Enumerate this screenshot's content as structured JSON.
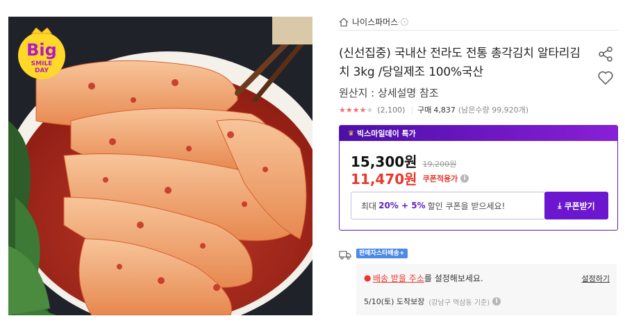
{
  "badge": {
    "line1": "Big",
    "line2": "SMILE",
    "line3": "DAY"
  },
  "seller": {
    "name": "나이스파머스"
  },
  "product": {
    "title": "(신선집중) 국내산 전라도 전통 총각김치 알타리김치 3kg /당일제조 100%국산",
    "origin": "원산지 : 상세설명 참조",
    "rating": 4.5,
    "review_count": "(2,100)",
    "purchase_label": "구매",
    "purchase_count": "4,837",
    "remaining": "(남은수량 99,920개)"
  },
  "deal": {
    "header": "빅스마일데이 특가",
    "price": "15,300원",
    "list_price": "19,200원",
    "coupon_price": "11,470원",
    "coupon_applied": "쿠폰적용가",
    "coupon_msg_prefix": "최대",
    "coupon_msg_highlight": "20% + 5%",
    "coupon_msg_suffix": "할인 쿠폰을 받으세요!",
    "coupon_button": "쿠폰받기"
  },
  "delivery": {
    "badge": "판매자스타배송+",
    "address_link": "배송 받을 주소",
    "address_suffix": "를 설정해보세요.",
    "set_link": "설정하기",
    "eta": "5/10(토) 도착보장",
    "eta_area": "(강남구 역삼동 기준)"
  },
  "colors": {
    "accent": "#6c17cf",
    "price_red": "#e8372d",
    "star": "#f26c6c"
  },
  "icons": [
    "home-icon",
    "chevron-right-icon",
    "share-icon",
    "heart-icon",
    "star-icon",
    "info-icon",
    "download-icon",
    "truck-icon",
    "location-pin-icon",
    "crown-icon"
  ]
}
